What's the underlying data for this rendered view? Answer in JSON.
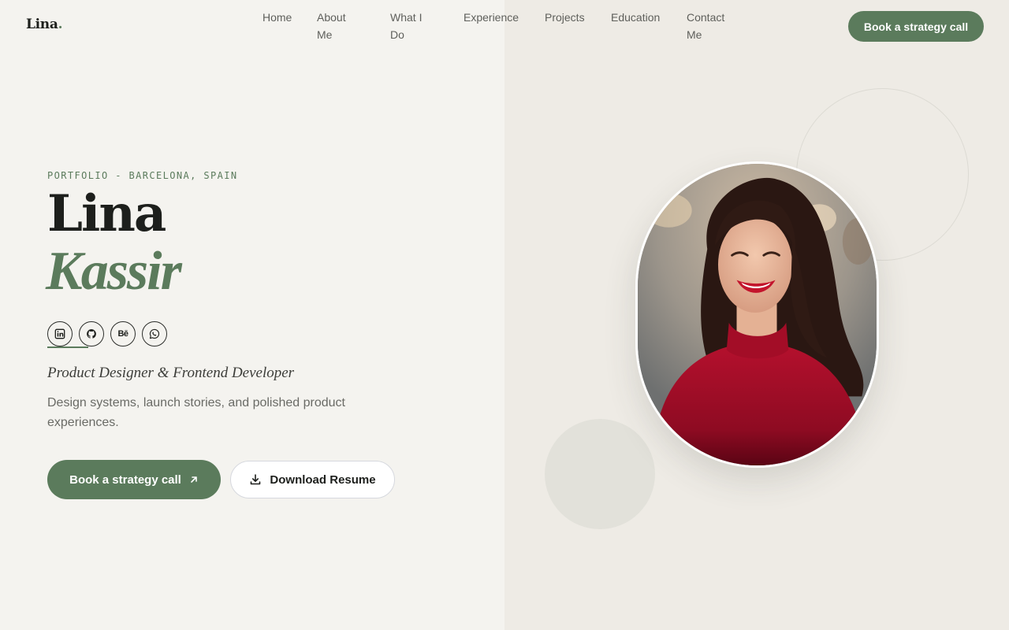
{
  "header": {
    "logo_text": "Lina",
    "logo_dot": ".",
    "nav": [
      {
        "label": "Home"
      },
      {
        "label": "About Me"
      },
      {
        "label": "What I Do"
      },
      {
        "label": "Experience"
      },
      {
        "label": "Projects"
      },
      {
        "label": "Education"
      },
      {
        "label": "Contact Me"
      }
    ],
    "cta_label": "Book a strategy call"
  },
  "hero": {
    "eyebrow": "PORTFOLIO - BARCELONA, SPAIN",
    "first_name": "Lina",
    "last_name": "Kassir",
    "socials": [
      {
        "icon": "linkedin-icon"
      },
      {
        "icon": "github-icon"
      },
      {
        "icon": "behance-icon"
      },
      {
        "icon": "whatsapp-icon"
      }
    ],
    "behance_glyph": "Bē",
    "role": "Product Designer & Frontend Developer",
    "description": "Design systems, launch stories, and polished product experiences.",
    "primary_button": "Book a strategy call",
    "secondary_button": "Download Resume"
  },
  "colors": {
    "accent": "#5b7b5c",
    "background_left": "#f4f3ef",
    "background_right": "#eeebe5",
    "text_dark": "#1d1f1c"
  }
}
